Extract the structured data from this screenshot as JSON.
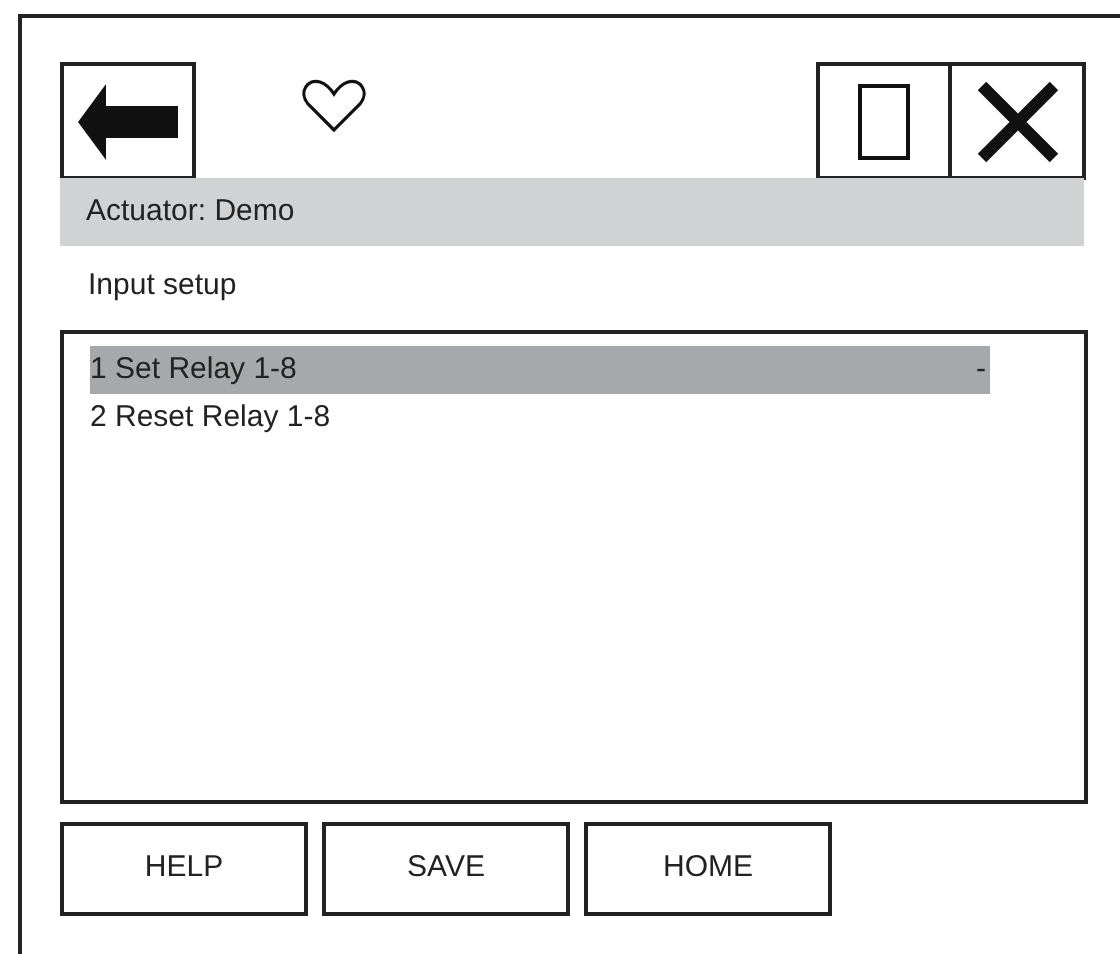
{
  "header": {
    "title": "Actuator: Demo"
  },
  "section_label": "Input setup",
  "list": [
    {
      "label": "1 Set Relay 1-8",
      "value": "-",
      "selected": true
    },
    {
      "label": "2 Reset Relay 1-8",
      "selected": false
    }
  ],
  "buttons": [
    "HELP",
    "SAVE",
    "HOME"
  ]
}
